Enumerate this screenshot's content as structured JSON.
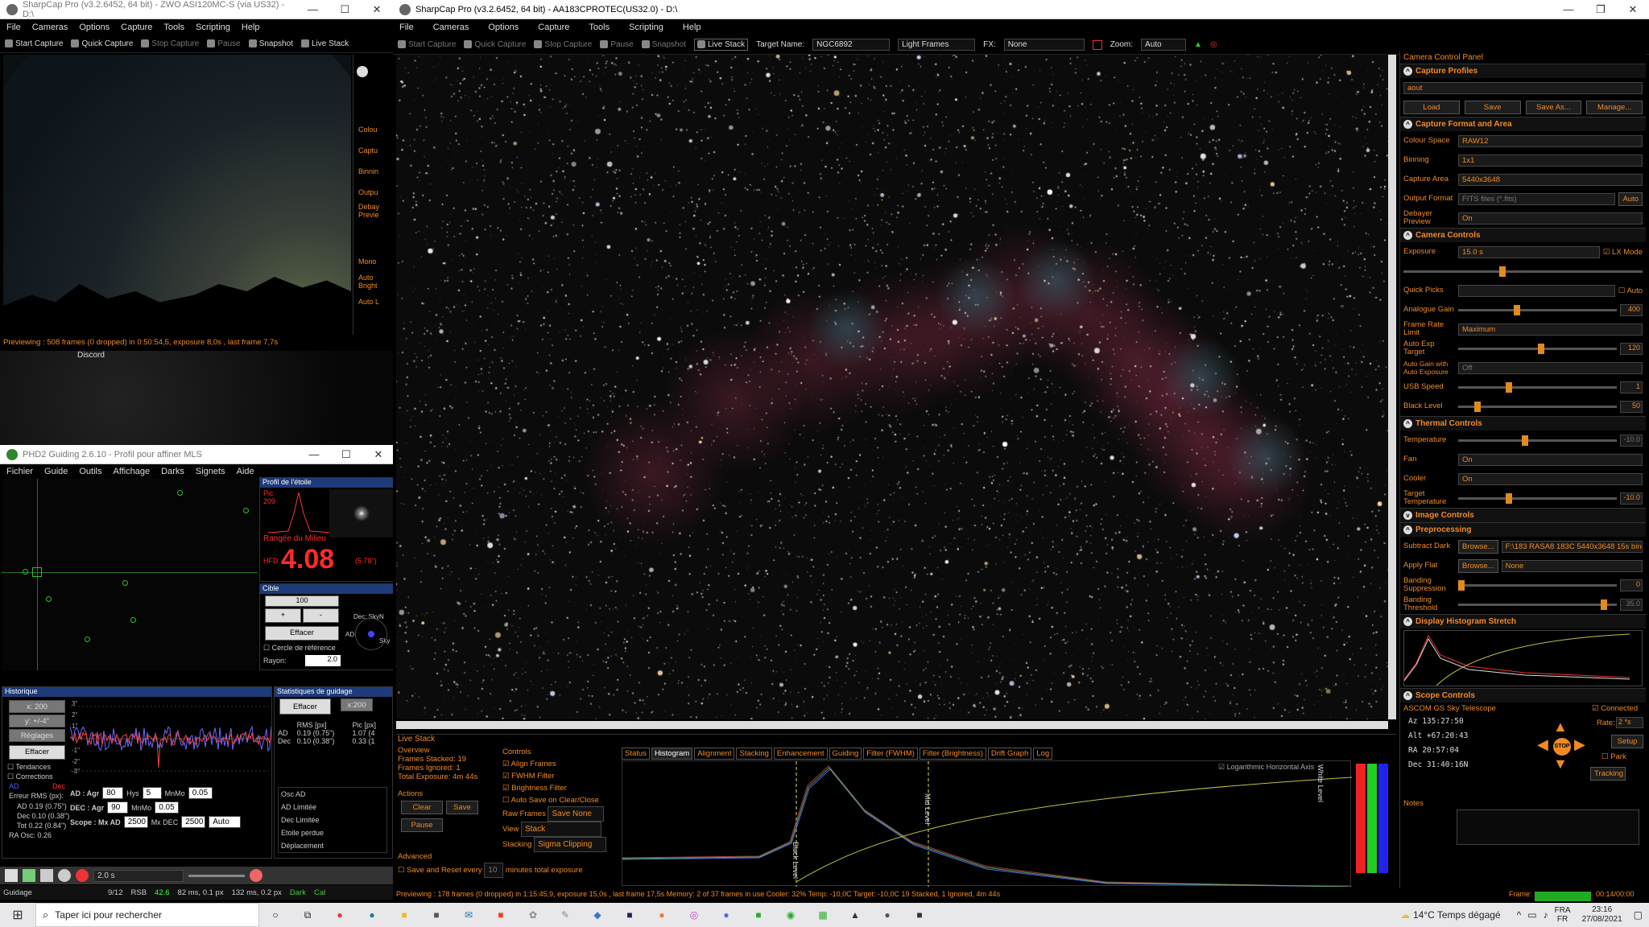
{
  "left_app": {
    "title": "SharpCap Pro (v3.2.6452, 64 bit) - ZWO ASI120MC-S (via US32) - D:\\",
    "menu": [
      "File",
      "Cameras",
      "Options",
      "Capture",
      "Tools",
      "Scripting",
      "Help"
    ],
    "toolbar": [
      "Start Capture",
      "Quick Capture",
      "Stop Capture",
      "Pause",
      "Snapshot",
      "Live Stack"
    ],
    "side_labels": [
      "Colou",
      "Captu",
      "Binnin",
      "Outpu",
      "Debay Previe",
      "Mono",
      "Auto Bright",
      "Auto L"
    ],
    "status": "Previewing : 508 frames (0 dropped) in 0:50:54,5, exposure 8,0s , last frame 7,7s",
    "discord_label": "Discord"
  },
  "phd2": {
    "title": "PHD2 Guiding 2.6.10 - Profil pour affiner MLS",
    "menu": [
      "Fichier",
      "Guide",
      "Outils",
      "Affichage",
      "Darks",
      "Signets",
      "Aide"
    ],
    "star_profile": {
      "title": "Profil de l'étoile",
      "pic_label": "Pic",
      "pic_value": "209",
      "mid_row": "Rangée du Milieu",
      "hfd_label": "HFD",
      "hfd_value": "4.08",
      "hfd_arcsec": "(5.78\")"
    },
    "target": {
      "title": "Cible",
      "zoom": "100",
      "plus": "+",
      "minus": "-",
      "clear": "Effacer",
      "ref_circle": "Cercle de référence",
      "radius_label": "Rayon:",
      "radius_value": "2.0",
      "dec_label": "Dec: SkyN",
      "ad_label": "AD:",
      "sky_label": "Sky"
    },
    "history": {
      "title": "Historique",
      "x": "x: 200",
      "y": "y: +/-4\"",
      "settings": "Réglages",
      "clear": "Effacer",
      "trends": "Tendances",
      "corrections": "Corrections",
      "ad": "AD",
      "dec": "Dec",
      "rms_title": "Erreur RMS (px):",
      "rms_ad": "AD 0.19 (0.75\")",
      "rms_dec": "Dec 0.10 (0.38\")",
      "rms_tot": "Tot 0.22 (0.84\")",
      "ra_osc": "RA Osc: 0.26",
      "y_ticks": [
        "3\"",
        "2\"",
        "1\"",
        "-1\"",
        "-2\"",
        "-3\""
      ]
    },
    "stats": {
      "title": "Statistiques de guidage",
      "clear": "Effacer",
      "zoom": "x:200",
      "headers": [
        "",
        "RMS [px]",
        "Pic [px]"
      ],
      "rows": [
        [
          "AD",
          "0.19 (0.75\")",
          "1.07 (4"
        ],
        [
          "Dec",
          "0.10 (0.38\")",
          "0.33 (1"
        ]
      ],
      "list": [
        "Osc AD",
        "AD Limitée",
        "Dec Limitée",
        "Etoile perdue",
        "Déplacement"
      ]
    },
    "controls": {
      "ad_label": "AD : Agr",
      "ad_agr": "80",
      "hys_label": "Hys",
      "hys": "5",
      "mnmo_label": "MnMo",
      "ad_mnmo": "0.05",
      "dec_label": "DEC : Agr",
      "dec_agr": "90",
      "dec_mnmo": "0.05",
      "scope_label": "Scope : Mx AD",
      "mx_ad": "2500",
      "mx_dec_label": "Mx DEC",
      "mx_dec": "2500",
      "mode": "Auto"
    },
    "bottom_toolbar": {
      "exposure": "2.0 s"
    },
    "status": {
      "state": "Guidage",
      "frame": "9/12",
      "rsb_label": "RSB",
      "rsb": "42.6",
      "ms1": "82 ms, 0.1 px",
      "ms2": "132 ms, 0.2 px",
      "dark": "Dark",
      "cal": "Cal"
    }
  },
  "main": {
    "title": "SharpCap Pro (v3.2.6452, 64 bit) - AA183CPROTEC(US32.0) - D:\\",
    "menu": [
      "File",
      "Cameras",
      "Options",
      "Capture",
      "Tools",
      "Scripting",
      "Help"
    ],
    "toolbar": {
      "start": "Start Capture",
      "quick": "Quick Capture",
      "stop": "Stop Capture",
      "pause": "Pause",
      "snapshot": "Snapshot",
      "live_stack": "Live Stack",
      "target_label": "Target Name:",
      "target": "NGC6892",
      "frames": "Light Frames",
      "fx_label": "FX:",
      "fx": "None",
      "zoom_label": "Zoom:",
      "zoom": "Auto"
    },
    "status_bar": "Previewing : 178 frames (0 dropped) in 1:15:45,9, exposure 15,0s , last frame 17,5s   Memory: 2 of 37 frames in use    Cooler: 32%   Temp: -10,0C   Target: -10,0C   19 Stacked, 1 Ignored, 4m 44s",
    "frame_label": "Frame:",
    "frame_time": "00:14/00:00"
  },
  "ccp": {
    "title": "Camera Control Panel",
    "sections": {
      "profiles": "Capture Profiles",
      "format": "Capture Format and Area",
      "camera": "Camera Controls",
      "thermal": "Thermal Controls",
      "image": "Image Controls",
      "preproc": "Preprocessing",
      "histogram": "Display Histogram Stretch",
      "scope": "Scope Controls"
    },
    "profile_value": "aout",
    "profile_buttons": [
      "Load",
      "Save",
      "Save As...",
      "Manage..."
    ],
    "colour_space": [
      "Colour Space",
      "RAW12"
    ],
    "binning": [
      "Binning",
      "1x1"
    ],
    "capture_area": [
      "Capture Area",
      "5440x3648"
    ],
    "output_format": [
      "Output Format",
      "FITS files (*.fits)",
      "Auto"
    ],
    "debayer": [
      "Debayer Preview",
      "On"
    ],
    "exposure": [
      "Exposure",
      "15.0 s",
      "LX Mode"
    ],
    "quick_picks": [
      "Quick Picks",
      "Auto"
    ],
    "analogue_gain": [
      "Analogue Gain",
      "400"
    ],
    "frame_rate": [
      "Frame Rate Limit",
      "Maximum"
    ],
    "auto_exp": [
      "Auto Exp Target",
      "120"
    ],
    "auto_gain": [
      "Auto Gain with Auto Exposure",
      "Off"
    ],
    "usb": [
      "USB Speed",
      "1"
    ],
    "black_level": [
      "Black Level",
      "50"
    ],
    "temperature": [
      "Temperature",
      "-10.0"
    ],
    "fan": [
      "Fan",
      "On"
    ],
    "cooler": [
      "Cooler",
      "On"
    ],
    "target_temp": [
      "Target Temperature",
      "-10.0"
    ],
    "subtract_dark": [
      "Subtract Dark",
      "Browse...",
      "F:\\183 RASA8 183C 5440x3648 15s bin 1..."
    ],
    "apply_flat": [
      "Apply Flat",
      "Browse...",
      "None"
    ],
    "banding_supp": [
      "Banding Suppression",
      "0"
    ],
    "banding_thr": [
      "Banding Threshold",
      "35.0"
    ],
    "scope": {
      "name": "ASCOM GS Sky Telescope",
      "connected": "Connected",
      "az_label": "Az",
      "az": "135:27:50",
      "alt_label": "Alt",
      "alt": "+67:20:43",
      "ra_label": "RA",
      "ra": "20:57:04",
      "dec_label": "Dec",
      "dec": "31:40:16N",
      "rate_label": "Rate:",
      "rate": "2 *s",
      "setup": "Setup",
      "park": "Park",
      "tracking": "Tracking",
      "stop": "STOP"
    },
    "notes_label": "Notes"
  },
  "live_stack": {
    "title": "Live Stack",
    "overview": {
      "title": "Overview",
      "rows": [
        [
          "Frames Stacked:",
          "19"
        ],
        [
          "Frames Ignored:",
          "1"
        ],
        [
          "Total Exposure:",
          "4m 44s"
        ]
      ]
    },
    "actions": {
      "title": "Actions",
      "clear": "Clear",
      "save": "Save",
      "pause": "Pause"
    },
    "controls": {
      "title": "Controls",
      "align": "Align Frames",
      "fwhm": "FWHM Filter",
      "brightness": "Brightness Filter",
      "autosave": "Auto Save on Clear/Close",
      "raw_label": "Raw Frames",
      "raw": "Save None",
      "view_label": "View",
      "view": "Stack",
      "stacking_label": "Stacking",
      "stacking": "Sigma Clipping"
    },
    "advanced": {
      "title": "Advanced",
      "save_reset": "Save and Reset every",
      "minutes": "10",
      "minutes_label": "minutes total exposure"
    },
    "tabs": [
      "Status",
      "Histogram",
      "Alignment",
      "Stacking",
      "Enhancement",
      "Guiding",
      "Filter (FWHM)",
      "Filter (Brightness)",
      "Drift Graph",
      "Log"
    ],
    "active_tab": "Histogram",
    "log_axis": "Logarithmic Horizontal Axis",
    "black_level": "Black Level",
    "mid_level": "Mid Level",
    "white_level": "White Level"
  },
  "taskbar": {
    "search": "Taper ici pour rechercher",
    "weather": "14°C  Temps dégagé",
    "lang1": "FRA",
    "lang2": "FR",
    "time": "23:16",
    "date": "27/08/2021"
  }
}
